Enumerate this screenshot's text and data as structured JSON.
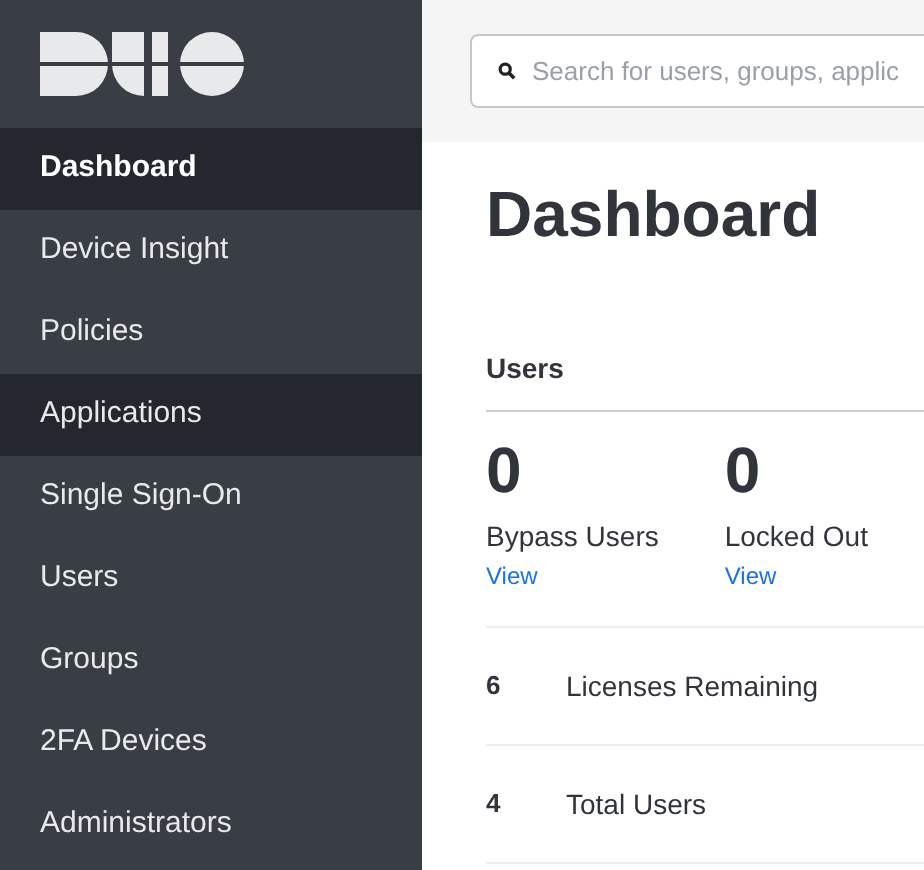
{
  "sidebar": {
    "items": [
      {
        "label": "Dashboard",
        "selected": true,
        "hovered": false
      },
      {
        "label": "Device Insight",
        "selected": false,
        "hovered": false
      },
      {
        "label": "Policies",
        "selected": false,
        "hovered": false
      },
      {
        "label": "Applications",
        "selected": false,
        "hovered": true
      },
      {
        "label": "Single Sign-On",
        "selected": false,
        "hovered": false
      },
      {
        "label": "Users",
        "selected": false,
        "hovered": false
      },
      {
        "label": "Groups",
        "selected": false,
        "hovered": false
      },
      {
        "label": "2FA Devices",
        "selected": false,
        "hovered": false
      },
      {
        "label": "Administrators",
        "selected": false,
        "hovered": false
      }
    ]
  },
  "search": {
    "placeholder": "Search for users, groups, applic"
  },
  "page_title": "Dashboard",
  "users_card": {
    "title": "Users",
    "stats": [
      {
        "value": "0",
        "label": "Bypass Users",
        "link": "View"
      },
      {
        "value": "0",
        "label": "Locked Out",
        "link": "View"
      }
    ],
    "rows": [
      {
        "count": "6",
        "label": "Licenses Remaining"
      },
      {
        "count": "4",
        "label": "Total Users"
      }
    ]
  }
}
